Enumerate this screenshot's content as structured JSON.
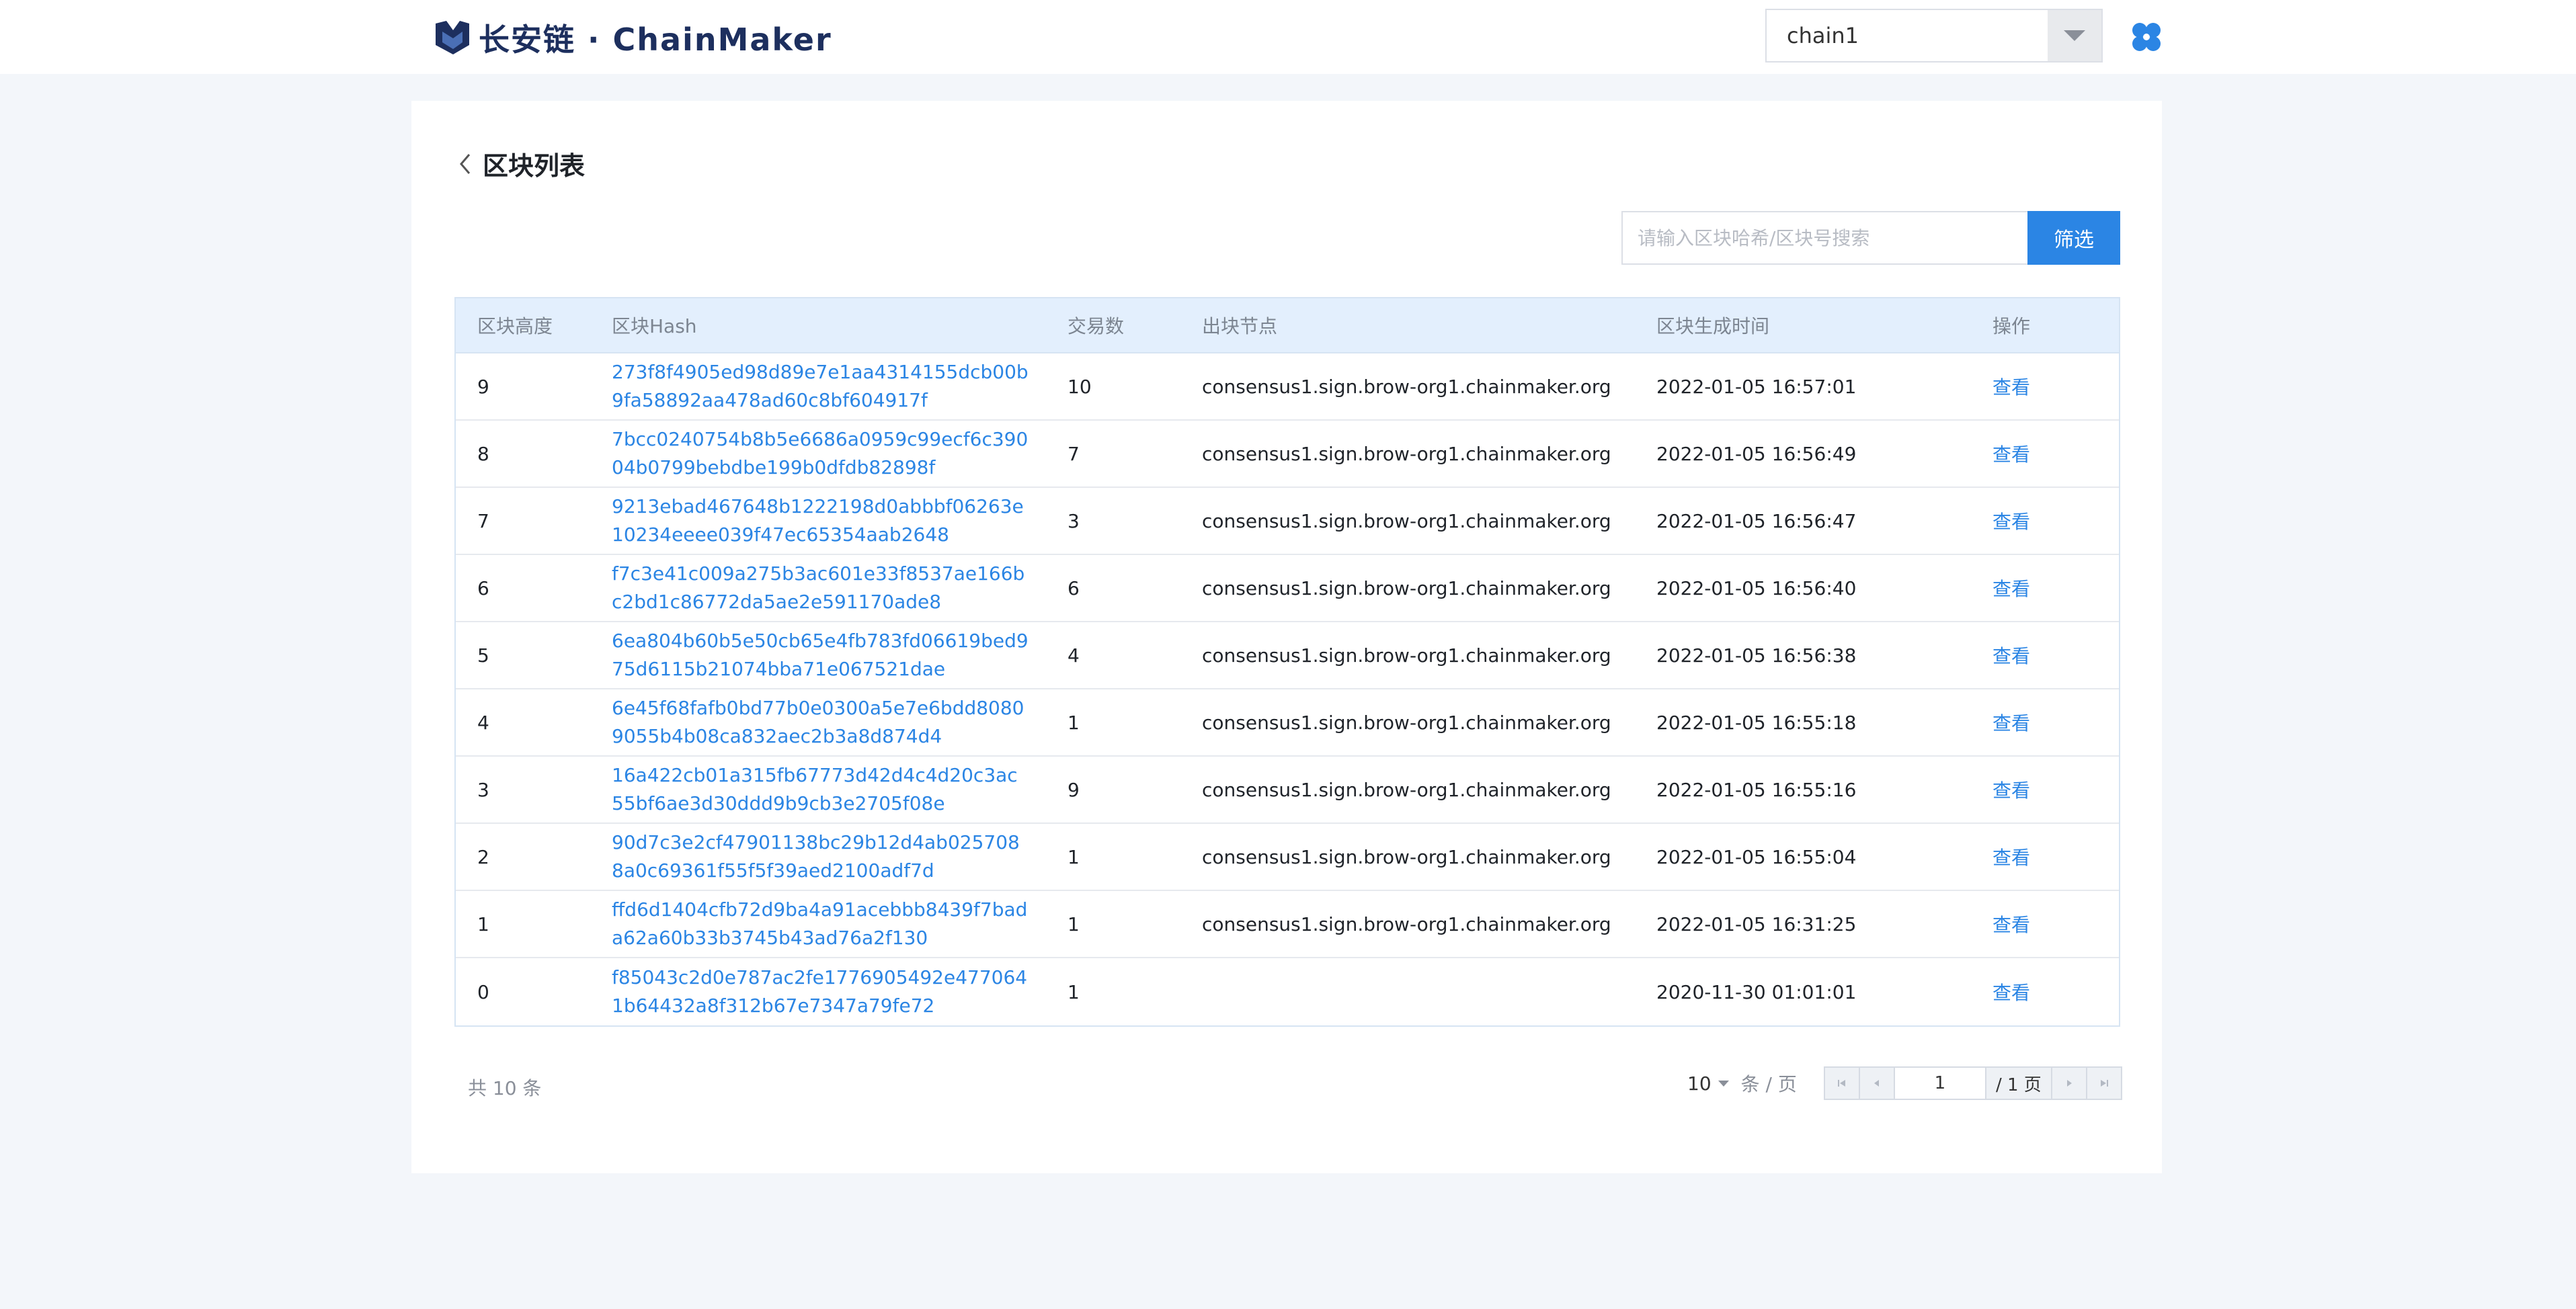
{
  "header": {
    "logo_text": "长安链 · ChainMaker",
    "chain_select_value": "chain1"
  },
  "page": {
    "title": "区块列表",
    "search_placeholder": "请输入区块哈希/区块号搜索",
    "filter_label": "筛选"
  },
  "table": {
    "columns": [
      "区块高度",
      "区块Hash",
      "交易数",
      "出块节点",
      "区块生成时间",
      "操作"
    ],
    "rows": [
      {
        "height": "9",
        "hash": "273f8f4905ed98d89e7e1aa4314155dcb00b9fa58892aa478ad60c8bf604917f",
        "tx": "10",
        "node": "consensus1.sign.brow-org1.chainmaker.org",
        "time": "2022-01-05 16:57:01",
        "op": "查看"
      },
      {
        "height": "8",
        "hash": "7bcc0240754b8b5e6686a0959c99ecf6c39004b0799bebdbe199b0dfdb82898f",
        "tx": "7",
        "node": "consensus1.sign.brow-org1.chainmaker.org",
        "time": "2022-01-05 16:56:49",
        "op": "查看"
      },
      {
        "height": "7",
        "hash": "9213ebad467648b1222198d0abbbf06263e10234eeee039f47ec65354aab2648",
        "tx": "3",
        "node": "consensus1.sign.brow-org1.chainmaker.org",
        "time": "2022-01-05 16:56:47",
        "op": "查看"
      },
      {
        "height": "6",
        "hash": "f7c3e41c009a275b3ac601e33f8537ae166bc2bd1c86772da5ae2e591170ade8",
        "tx": "6",
        "node": "consensus1.sign.brow-org1.chainmaker.org",
        "time": "2022-01-05 16:56:40",
        "op": "查看"
      },
      {
        "height": "5",
        "hash": "6ea804b60b5e50cb65e4fb783fd06619bed975d6115b21074bba71e067521dae",
        "tx": "4",
        "node": "consensus1.sign.brow-org1.chainmaker.org",
        "time": "2022-01-05 16:56:38",
        "op": "查看"
      },
      {
        "height": "4",
        "hash": "6e45f68fafb0bd77b0e0300a5e7e6bdd80809055b4b08ca832aec2b3a8d874d4",
        "tx": "1",
        "node": "consensus1.sign.brow-org1.chainmaker.org",
        "time": "2022-01-05 16:55:18",
        "op": "查看"
      },
      {
        "height": "3",
        "hash": "16a422cb01a315fb67773d42d4c4d20c3ac55bf6ae3d30ddd9b9cb3e2705f08e",
        "tx": "9",
        "node": "consensus1.sign.brow-org1.chainmaker.org",
        "time": "2022-01-05 16:55:16",
        "op": "查看"
      },
      {
        "height": "2",
        "hash": "90d7c3e2cf47901138bc29b12d4ab0257088a0c69361f55f5f39aed2100adf7d",
        "tx": "1",
        "node": "consensus1.sign.brow-org1.chainmaker.org",
        "time": "2022-01-05 16:55:04",
        "op": "查看"
      },
      {
        "height": "1",
        "hash": "ffd6d1404cfb72d9ba4a91acebbb8439f7bada62a60b33b3745b43ad76a2f130",
        "tx": "1",
        "node": "consensus1.sign.brow-org1.chainmaker.org",
        "time": "2022-01-05 16:31:25",
        "op": "查看"
      },
      {
        "height": "0",
        "hash": "f85043c2d0e787ac2fe1776905492e4770641b64432a8f312b67e7347a79fe72",
        "tx": "1",
        "node": "",
        "time": "2020-11-30 01:01:01",
        "op": "查看"
      }
    ]
  },
  "footer": {
    "total": "共 10 条",
    "page_size": "10",
    "per_page_label": "条 / 页",
    "current_page": "1",
    "total_pages": "/ 1 页"
  },
  "colors": {
    "accent": "#2b85e4",
    "header_bg": "#e3effd",
    "page_bg": "#f3f6fa"
  },
  "icons": {
    "logo": "chainmaker-logo-icon",
    "app": "clover-app-icon",
    "back": "chevron-left-icon"
  }
}
